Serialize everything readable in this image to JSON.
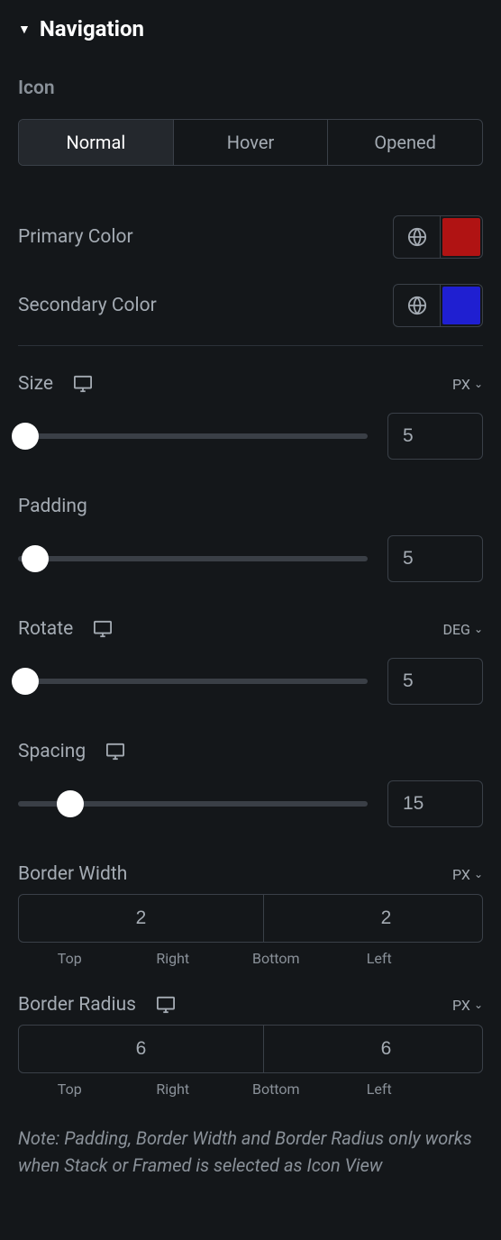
{
  "panel": {
    "title": "Navigation"
  },
  "icon": {
    "section_label": "Icon",
    "tabs": {
      "normal": "Normal",
      "hover": "Hover",
      "opened": "Opened",
      "active_index": 0
    }
  },
  "colors": {
    "primary": {
      "label": "Primary Color",
      "value": "#b01313"
    },
    "secondary": {
      "label": "Secondary Color",
      "value": "#1f1fd1"
    }
  },
  "size": {
    "label": "Size",
    "unit": "PX",
    "value": "5",
    "percent": 2
  },
  "padding": {
    "label": "Padding",
    "value": "5",
    "percent": 5
  },
  "rotate": {
    "label": "Rotate",
    "unit": "DEG",
    "value": "5",
    "percent": 2
  },
  "spacing": {
    "label": "Spacing",
    "value": "15",
    "percent": 15
  },
  "border_width": {
    "label": "Border Width",
    "unit": "PX",
    "top": "2",
    "right": "2",
    "bottom": "2",
    "left": "2"
  },
  "border_radius": {
    "label": "Border Radius",
    "unit": "PX",
    "top": "6",
    "right": "6",
    "bottom": "6",
    "left": "6"
  },
  "dim_labels": {
    "top": "Top",
    "right": "Right",
    "bottom": "Bottom",
    "left": "Left"
  },
  "note": "Note: Padding, Border Width and Border Radius only works when Stack or Framed is selected as Icon View"
}
